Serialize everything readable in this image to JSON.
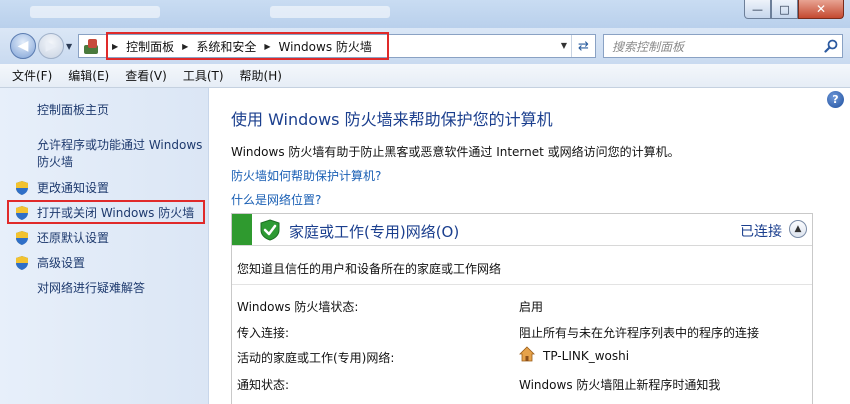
{
  "window": {
    "minimize_glyph": "—",
    "maximize_glyph": "□",
    "close_glyph": "✕"
  },
  "address": {
    "breadcrumbs": [
      "控制面板",
      "系统和安全",
      "Windows 防火墙"
    ],
    "search_placeholder": "搜索控制面板"
  },
  "menu": [
    "文件(F)",
    "编辑(E)",
    "查看(V)",
    "工具(T)",
    "帮助(H)"
  ],
  "sidebar": {
    "home": "控制面板主页",
    "allow_line1": "允许程序或功能通过 Windows",
    "allow_line2": "防火墙",
    "items": [
      {
        "label": "更改通知设置",
        "icon": "uac-shield-icon"
      },
      {
        "label": "打开或关闭 Windows 防火墙",
        "icon": "uac-shield-icon"
      },
      {
        "label": "还原默认设置",
        "icon": "uac-shield-icon"
      },
      {
        "label": "高级设置",
        "icon": "uac-shield-icon"
      }
    ],
    "troubleshoot": "对网络进行疑难解答"
  },
  "main": {
    "help_glyph": "?",
    "title": "使用 Windows 防火墙来帮助保护您的计算机",
    "description": "Windows 防火墙有助于防止黑客或恶意软件通过 Internet 或网络访问您的计算机。",
    "link_help": "防火墙如何帮助保护计算机?",
    "link_location": "什么是网络位置?"
  },
  "network": {
    "title": "家庭或工作(专用)网络(O)",
    "status": "已连接",
    "description": "您知道且信任的用户和设备所在的家庭或工作网络",
    "rows": [
      {
        "label": "Windows 防火墙状态:",
        "value": "启用"
      },
      {
        "label": "传入连接:",
        "value": "阻止所有与未在允许程序列表中的程序的连接"
      },
      {
        "label": "活动的家庭或工作(专用)网络:",
        "value": "TP-LINK_woshi"
      },
      {
        "label": "通知状态:",
        "value": "Windows 防火墙阻止新程序时通知我"
      }
    ]
  },
  "colors": {
    "accent_green": "#2f9a2f",
    "link_blue": "#1a5fb4",
    "title_blue": "#1b3f8e",
    "highlight_red": "#e02a2a"
  }
}
